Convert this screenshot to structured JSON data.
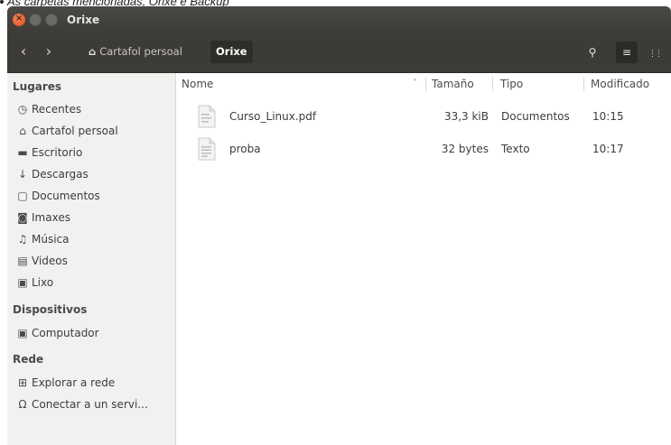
{
  "caption": "As carpetas mencionadas, Orixe e Backup",
  "window": {
    "title": "Orixe",
    "close_symbol": "×",
    "minimize_symbol": "",
    "maximize_symbol": ""
  },
  "toolbar": {
    "back_icon": "‹",
    "forward_icon": "›",
    "breadcrumb_home": "Cartafol persoal",
    "breadcrumb_current": "Orixe",
    "home_icon": "⌂",
    "search_icon": "⚲",
    "list_icon": "≡",
    "grid_icon": "⋮⋮"
  },
  "sidebar": {
    "places_heading": "Lugares",
    "places": [
      {
        "icon": "◷",
        "label": "Recentes"
      },
      {
        "icon": "⌂",
        "label": "Cartafol persoal"
      },
      {
        "icon": "▬",
        "label": "Escritorio"
      },
      {
        "icon": "↓",
        "label": "Descargas"
      },
      {
        "icon": "▢",
        "label": "Documentos"
      },
      {
        "icon": "◙",
        "label": "Imaxes"
      },
      {
        "icon": "♫",
        "label": "Música"
      },
      {
        "icon": "▤",
        "label": "Videos"
      },
      {
        "icon": "▣",
        "label": "Lixo"
      }
    ],
    "devices_heading": "Dispositivos",
    "devices": [
      {
        "icon": "▣",
        "label": "Computador"
      }
    ],
    "network_heading": "Rede",
    "network": [
      {
        "icon": "⊞",
        "label": "Explorar a rede"
      },
      {
        "icon": "Ω",
        "label": "Conectar a un servi..."
      }
    ]
  },
  "columns": {
    "name": "Nome",
    "sort_indicator": "˄",
    "size": "Tamaño",
    "type": "Tipo",
    "modified": "Modificado"
  },
  "files": [
    {
      "name": "Curso_Linux.pdf",
      "size": "33,3 kiB",
      "type": "Documentos",
      "modified": "10:15"
    },
    {
      "name": "proba",
      "size": "32 bytes",
      "type": "Texto",
      "modified": "10:17"
    }
  ]
}
